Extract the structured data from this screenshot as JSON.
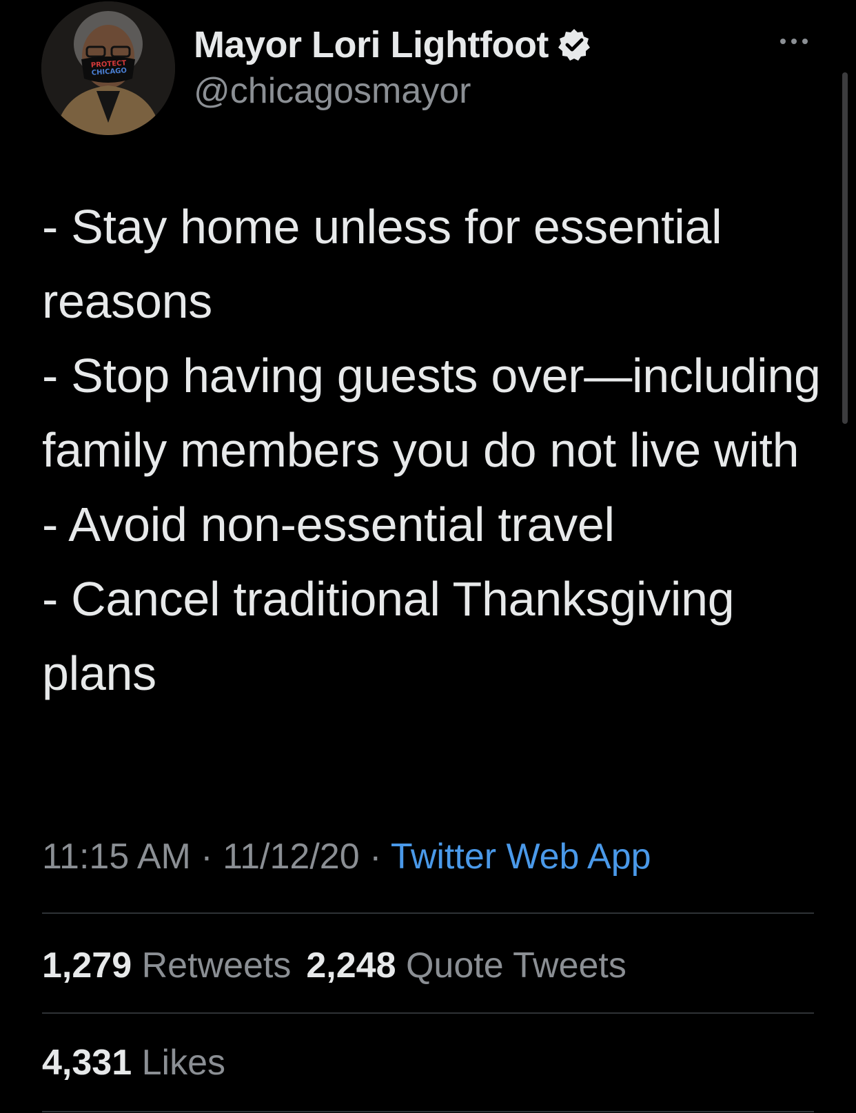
{
  "author": {
    "display_name": "Mayor Lori Lightfoot",
    "handle": "@chicagosmayor",
    "verified": true,
    "avatar_mask_text": [
      "PROTECT",
      "CHICAGO"
    ]
  },
  "tweet": {
    "text": "- Stay home unless for essential reasons\n- Stop having guests over—including family members you do not live with\n- Avoid non-essential travel\n- Cancel traditional Thanksgiving plans",
    "time": "11:15 AM",
    "date": "11/12/20",
    "separator": " · ",
    "source": "Twitter Web App"
  },
  "stats": {
    "retweets": {
      "count": "1,279",
      "label": "Retweets"
    },
    "quote_tweets": {
      "count": "2,248",
      "label": "Quote Tweets"
    },
    "likes": {
      "count": "4,331",
      "label": "Likes"
    }
  },
  "icons": {
    "verified": "verified-badge-icon",
    "more": "more-options-icon"
  },
  "colors": {
    "background": "#000000",
    "primary_text": "#e7e9ea",
    "secondary_text": "#8b8f94",
    "link": "#4a99e9",
    "divider": "#2f3336"
  }
}
